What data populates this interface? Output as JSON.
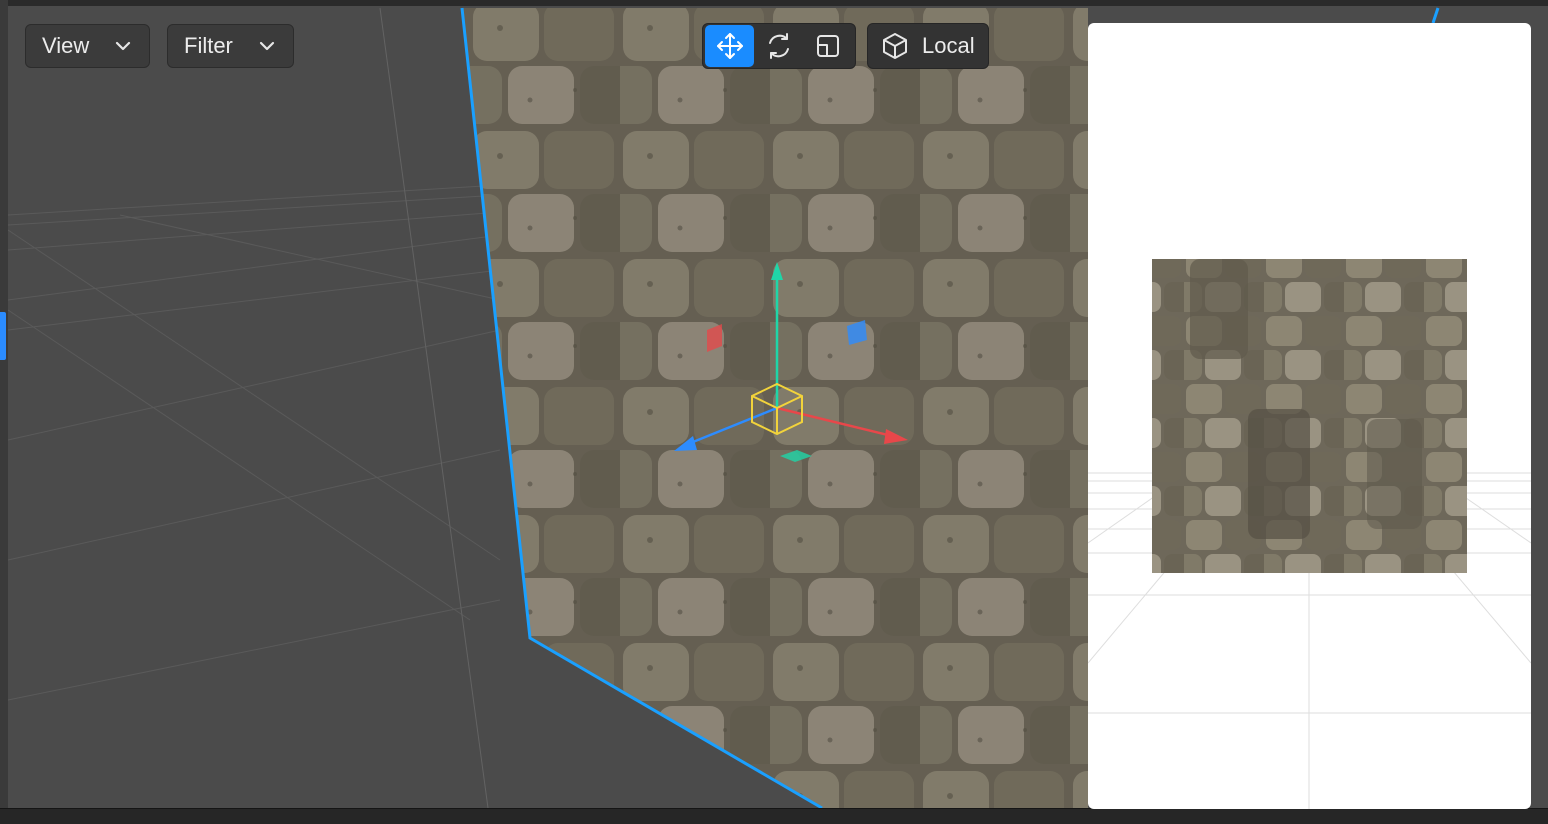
{
  "toolbar": {
    "view_menu": {
      "label": "View",
      "icon": "chevron-down-icon"
    },
    "filter_menu": {
      "label": "Filter",
      "icon": "chevron-down-icon"
    },
    "transform_tools": [
      {
        "id": "move",
        "icon": "move-icon",
        "active": true
      },
      {
        "id": "rotate",
        "icon": "rotate-icon",
        "active": false
      },
      {
        "id": "scale",
        "icon": "scale-icon",
        "active": false
      }
    ],
    "space_toggle": {
      "label": "Local",
      "icon": "cube-icon"
    }
  },
  "colors": {
    "accent": "#1a8cff",
    "selection_outline": "#1aa0ff",
    "gizmo_x": "#e8474a",
    "gizmo_y": "#1fd6a8",
    "gizmo_z": "#2d8cff",
    "gizmo_center": "#f2d33b",
    "viewport_bg": "#4b4b4b",
    "preview_bg": "#ffffff"
  },
  "viewport": {
    "object": "stone-brick-textured-plane",
    "gizmo": "move-gizmo"
  },
  "preview": {
    "content": "texture-preview-thumbnail"
  }
}
